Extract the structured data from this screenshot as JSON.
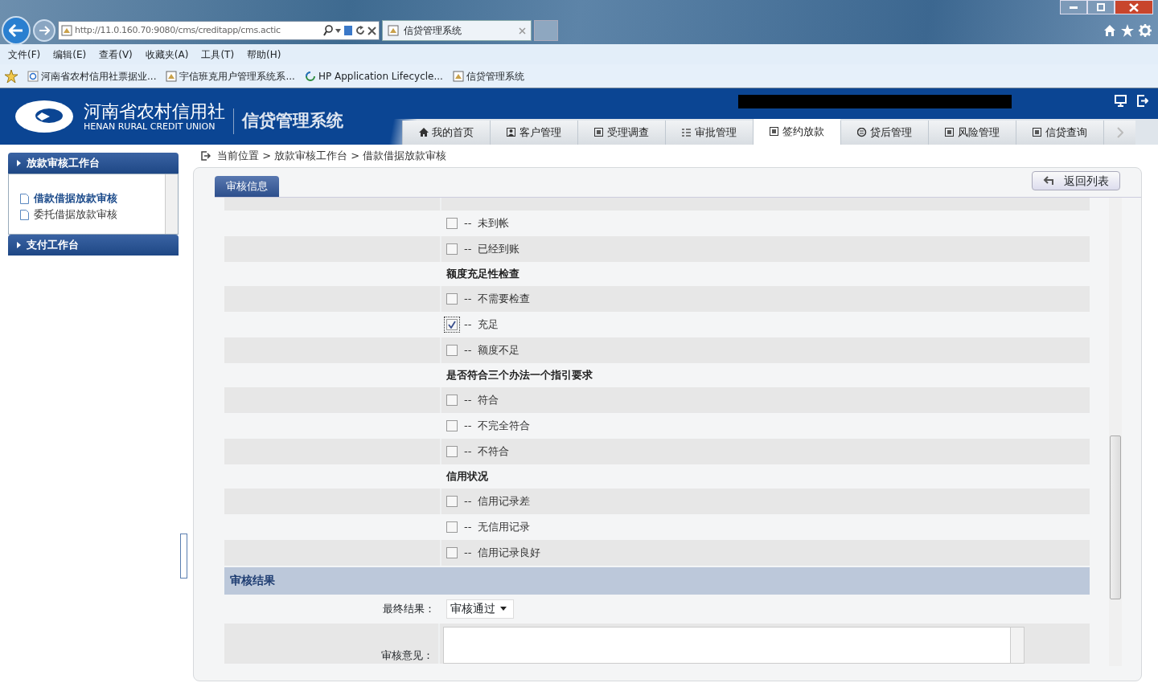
{
  "browser": {
    "address": "http://11.0.160.70:9080/cms/creditapp/cms.actic",
    "tab_title": "信贷管理系统",
    "menu": [
      "文件(F)",
      "编辑(E)",
      "查看(V)",
      "收藏夹(A)",
      "工具(T)",
      "帮助(H)"
    ],
    "favorites": [
      {
        "label": "河南省农村信用社票据业...",
        "kind": "ie"
      },
      {
        "label": "宇信班克用户管理系统系...",
        "kind": "page"
      },
      {
        "label": "HP Application Lifecycle...",
        "kind": "sync"
      },
      {
        "label": "信贷管理系统",
        "kind": "page"
      }
    ]
  },
  "header": {
    "logo_cn": "河南省农村信用社",
    "logo_en": "HENAN RURAL CREDIT UNION",
    "system_title": "信贷管理系统",
    "nav_tabs": [
      {
        "label": "我的首页",
        "selected": false
      },
      {
        "label": "客户管理",
        "selected": false
      },
      {
        "label": "受理调查",
        "selected": false
      },
      {
        "label": "审批管理",
        "selected": false
      },
      {
        "label": "签约放款",
        "selected": true
      },
      {
        "label": "贷后管理",
        "selected": false
      },
      {
        "label": "风险管理",
        "selected": false
      },
      {
        "label": "信贷查询",
        "selected": false
      }
    ]
  },
  "sidebar": {
    "groups": [
      {
        "title": "放款审核工作台",
        "expanded": true,
        "items": [
          {
            "label": "借款借据放款审核",
            "selected": true
          },
          {
            "label": "委托借据放款审核",
            "selected": false
          }
        ]
      },
      {
        "title": "支付工作台",
        "expanded": false
      }
    ]
  },
  "breadcrumb": "当前位置 > 放款审核工作台 > 借款借据放款审核",
  "panel_tab": "审核信息",
  "back_button": "返回列表",
  "form_rows": [
    {
      "kind": "option",
      "dash": "--",
      "label": "未到帐",
      "checked": false
    },
    {
      "kind": "option",
      "dash": "--",
      "label": "已经到账",
      "checked": false
    },
    {
      "kind": "heading",
      "label": "额度充足性检查"
    },
    {
      "kind": "option",
      "dash": "--",
      "label": "不需要检查",
      "checked": false
    },
    {
      "kind": "option",
      "dash": "--",
      "label": "充足",
      "checked": true
    },
    {
      "kind": "option",
      "dash": "--",
      "label": "额度不足",
      "checked": false
    },
    {
      "kind": "heading",
      "label": "是否符合三个办法一个指引要求"
    },
    {
      "kind": "option",
      "dash": "--",
      "label": "符合",
      "checked": false
    },
    {
      "kind": "option",
      "dash": "--",
      "label": "不完全符合",
      "checked": false
    },
    {
      "kind": "option",
      "dash": "--",
      "label": "不符合",
      "checked": false
    },
    {
      "kind": "heading",
      "label": "信用状况"
    },
    {
      "kind": "option",
      "dash": "--",
      "label": "信用记录差",
      "checked": false
    },
    {
      "kind": "option",
      "dash": "--",
      "label": "无信用记录",
      "checked": false
    },
    {
      "kind": "option",
      "dash": "--",
      "label": "信用记录良好",
      "checked": false
    }
  ],
  "result_section": {
    "title": "审核结果",
    "final_label": "最终结果：",
    "final_value": "审核通过",
    "opinion_label": "审核意见："
  }
}
